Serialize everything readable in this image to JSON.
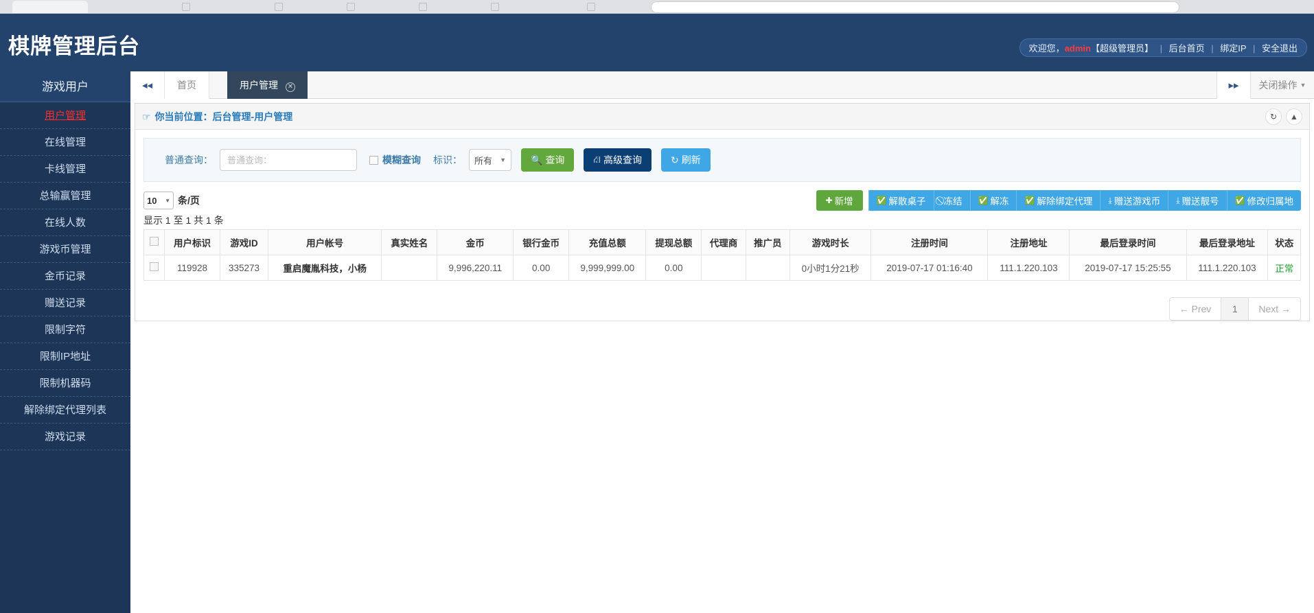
{
  "header": {
    "app_title": "棋牌管理后台",
    "welcome_prefix": "欢迎您，",
    "admin_name": "admin",
    "admin_role": "【超级管理员】",
    "links": [
      "后台首页",
      "绑定IP",
      "安全退出"
    ]
  },
  "sidebar": {
    "title": "游戏用户",
    "items": [
      {
        "label": "用户管理",
        "active": true
      },
      {
        "label": "在线管理",
        "active": false
      },
      {
        "label": "卡线管理",
        "active": false
      },
      {
        "label": "总输赢管理",
        "active": false
      },
      {
        "label": "在线人数",
        "active": false
      },
      {
        "label": "游戏币管理",
        "active": false
      },
      {
        "label": "金币记录",
        "active": false
      },
      {
        "label": "赠送记录",
        "active": false
      },
      {
        "label": "限制字符",
        "active": false
      },
      {
        "label": "限制IP地址",
        "active": false
      },
      {
        "label": "限制机器码",
        "active": false
      },
      {
        "label": "解除绑定代理列表",
        "active": false
      },
      {
        "label": "游戏记录",
        "active": false
      }
    ]
  },
  "tabbar": {
    "prev_icon": "chevron-double-left",
    "next_icon": "chevron-double-right",
    "home_tab": "首页",
    "active_tab": "用户管理",
    "close_ops": "关闭操作"
  },
  "panel": {
    "breadcrumb": "你当前位置：后台管理-用户管理",
    "refresh_icon": "refresh-icon",
    "collapse_icon": "chevron-up-icon"
  },
  "search": {
    "label": "普通查询：",
    "placeholder": "普通查询：",
    "value": "",
    "fuzzy_label": "模糊查询",
    "fuzzy_checked": false,
    "flag_label": "标识：",
    "flag_value": "所有",
    "flag_options": [
      "所有"
    ],
    "btn_query": "查询",
    "btn_advanced": "高级查询",
    "btn_refresh": "刷新"
  },
  "toolbar": {
    "per_page": "10",
    "per_page_unit": "条/页",
    "showing": "显示 1 至 1 共 1 条",
    "buttons": [
      {
        "label": "新增",
        "icon": "plus-icon",
        "style": "green"
      },
      {
        "label": "解散桌子",
        "icon": "check-circle-icon",
        "style": "blue"
      },
      {
        "label": "冻结",
        "icon": "ban-icon",
        "style": "blue"
      },
      {
        "label": "解冻",
        "icon": "check-circle-icon",
        "style": "blue"
      },
      {
        "label": "解除绑定代理",
        "icon": "check-circle-icon",
        "style": "blue"
      },
      {
        "label": "赠送游戏币",
        "icon": "gift-icon",
        "style": "blue"
      },
      {
        "label": "赠送靓号",
        "icon": "gift-icon",
        "style": "blue"
      },
      {
        "label": "修改归属地",
        "icon": "check-circle-icon",
        "style": "blue"
      }
    ]
  },
  "table": {
    "columns": [
      "用户标识",
      "游戏ID",
      "用户帐号",
      "真实姓名",
      "金币",
      "银行金币",
      "充值总额",
      "提现总额",
      "代理商",
      "推广员",
      "游戏时长",
      "注册时间",
      "注册地址",
      "最后登录时间",
      "最后登录地址",
      "状态"
    ],
    "rows": [
      {
        "用户标识": "119928",
        "游戏ID": "335273",
        "用户帐号": "重启魔胤科技，小杨",
        "真实姓名": "",
        "金币": "9,996,220.11",
        "银行金币": "0.00",
        "充值总额": "9,999,999.00",
        "提现总额": "0.00",
        "代理商": "",
        "推广员": "",
        "游戏时长": "0小时1分21秒",
        "注册时间": "2019-07-17 01:16:40",
        "注册地址": "111.1.220.103",
        "最后登录时间": "2019-07-17 15:25:55",
        "最后登录地址": "111.1.220.103",
        "状态": "正常"
      }
    ]
  },
  "pagination": {
    "prev": "← Prev",
    "current": "1",
    "next": "Next →"
  },
  "colors": {
    "header_bg": "#23426c",
    "sidebar_bg": "#1d3658",
    "accent_blue": "#3fa7e6",
    "accent_green": "#5fa73c",
    "accent_navy": "#0b3f73",
    "active_red": "#ff2d2d",
    "status_green": "#1f9d2f",
    "breadcrumb_blue": "#2a7bb9"
  }
}
